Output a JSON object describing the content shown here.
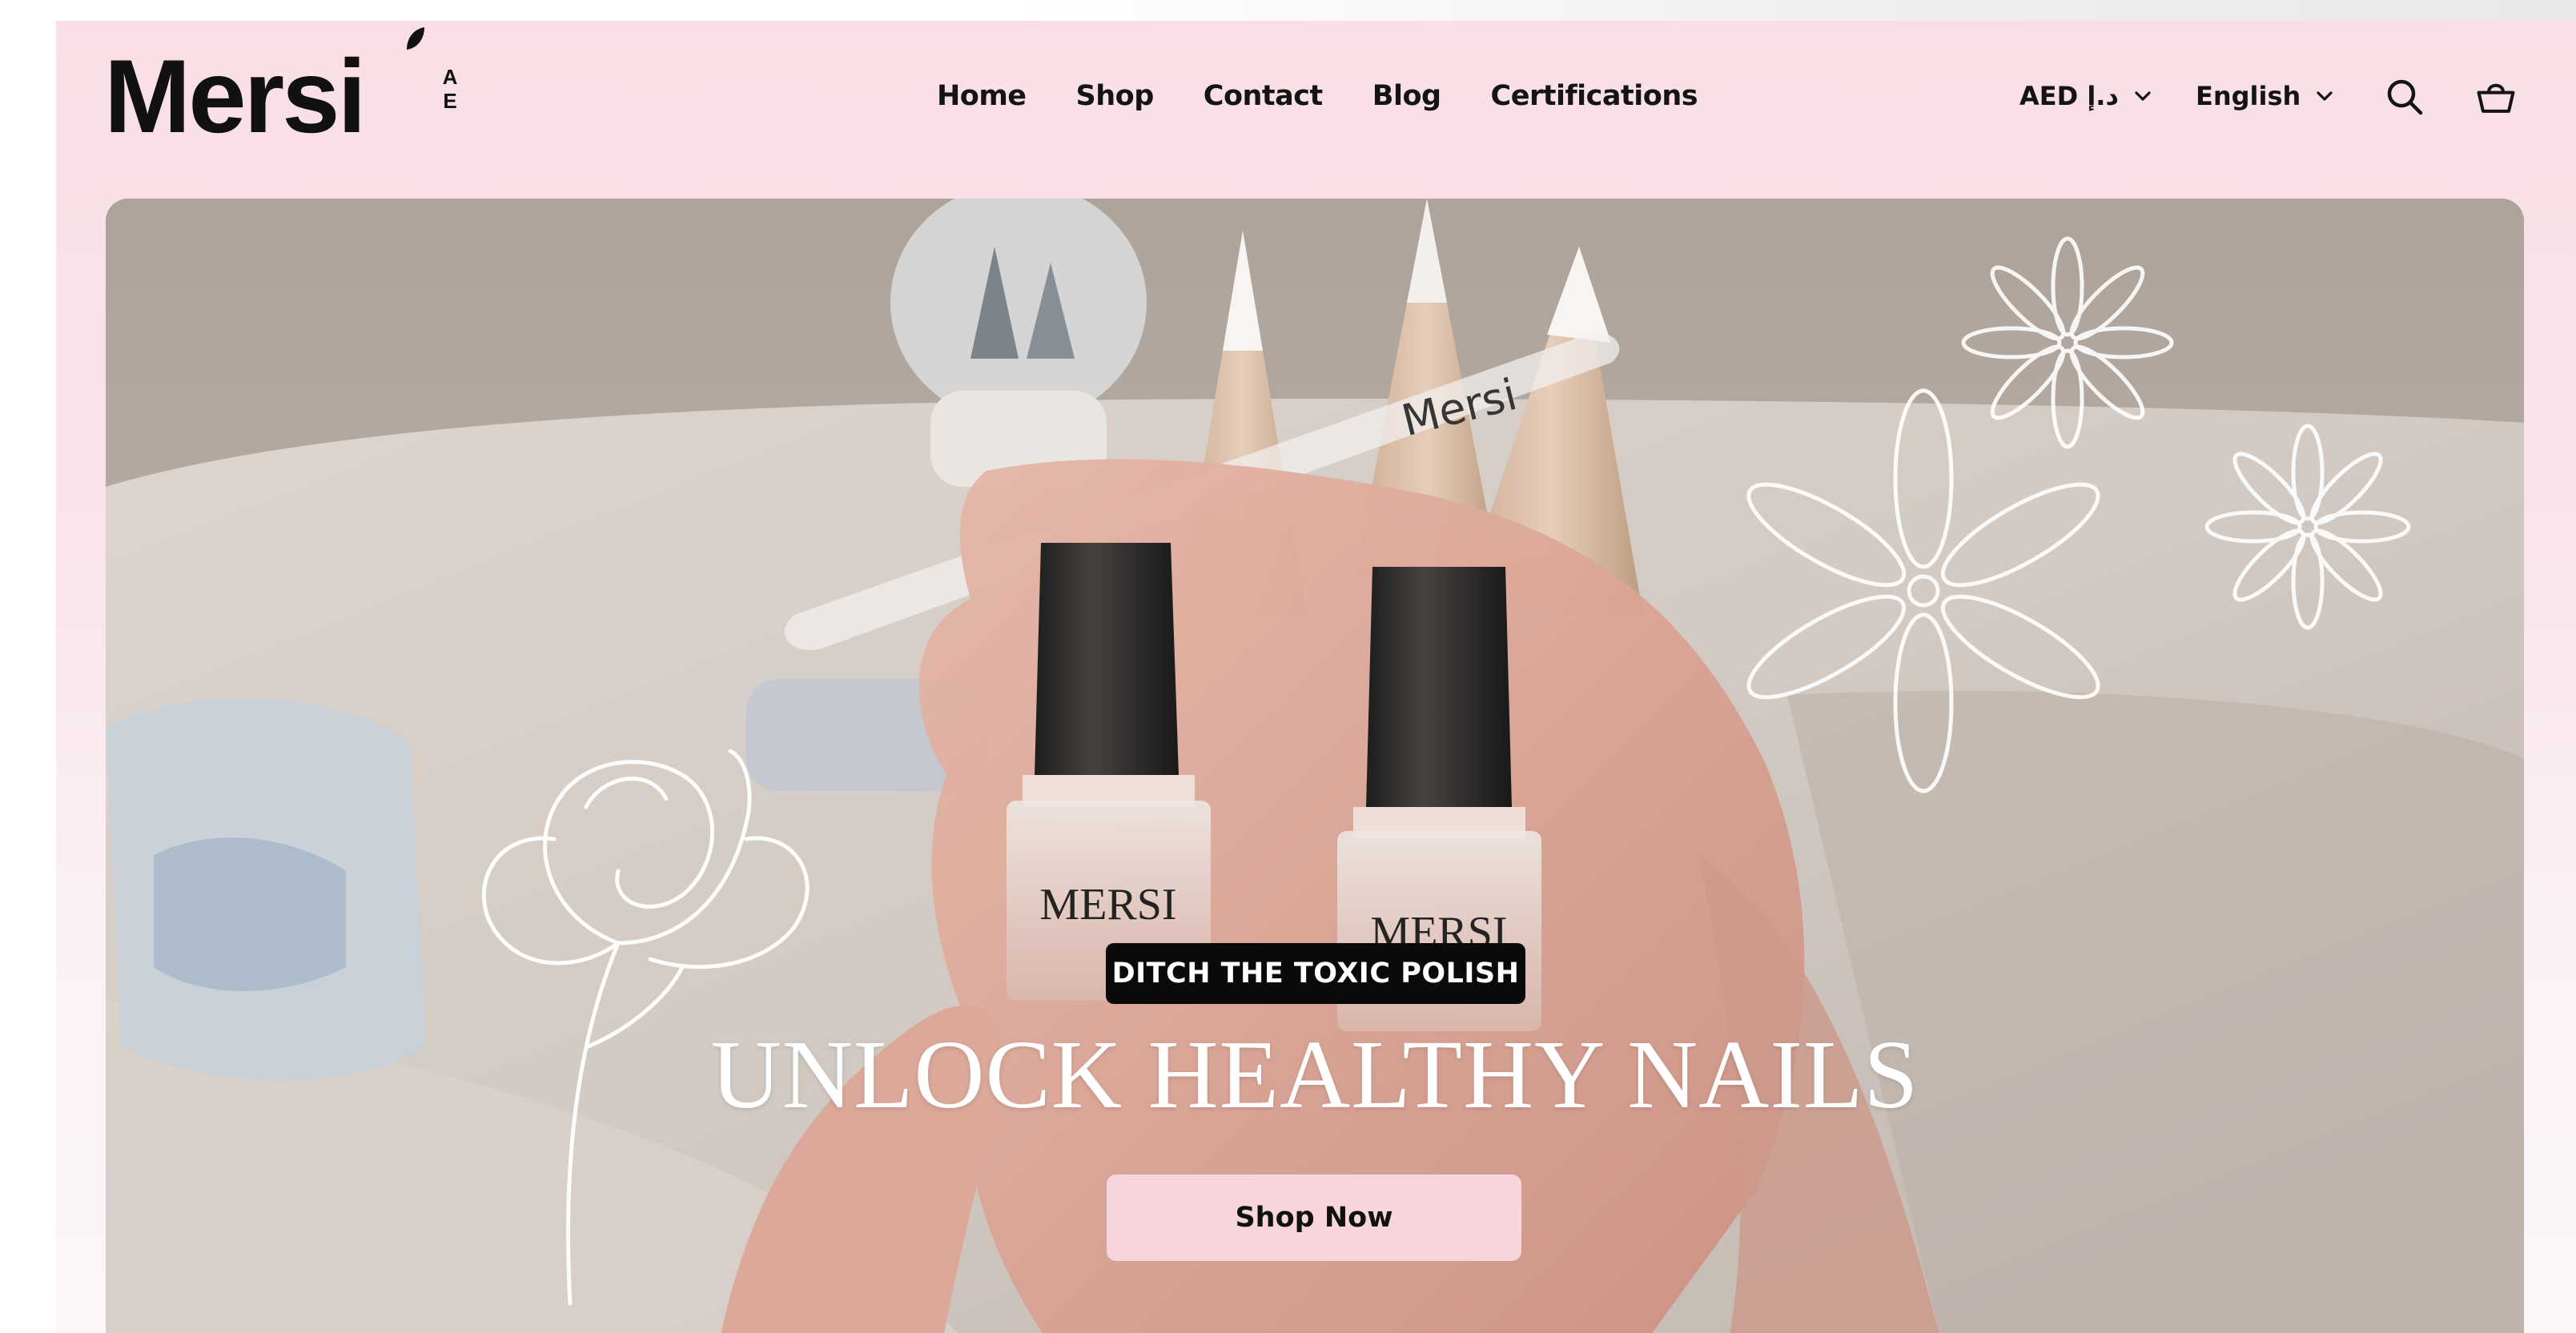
{
  "brand": {
    "logo_text": "Mersi",
    "logo_sub_1": "A",
    "logo_sub_2": "E"
  },
  "nav": {
    "items": [
      {
        "label": "Home"
      },
      {
        "label": "Shop"
      },
      {
        "label": "Contact"
      },
      {
        "label": "Blog"
      },
      {
        "label": "Certifications"
      }
    ]
  },
  "header": {
    "currency_label": "AED د.إ",
    "language_label": "English",
    "icons": [
      "search-icon",
      "cart-icon",
      "chevron-down-icon"
    ]
  },
  "hero": {
    "badge": "DITCH THE TOXIC POLISH",
    "headline": "UNLOCK HEALTHY NAILS",
    "cta_label": "Shop Now",
    "bottle_label": "MERSI",
    "file_label": "Mersi"
  },
  "colors": {
    "header_bg": "#f9dfe5",
    "cta_bg": "#f6d5dc",
    "badge_bg": "#0a0a0a",
    "text": "#141414"
  }
}
